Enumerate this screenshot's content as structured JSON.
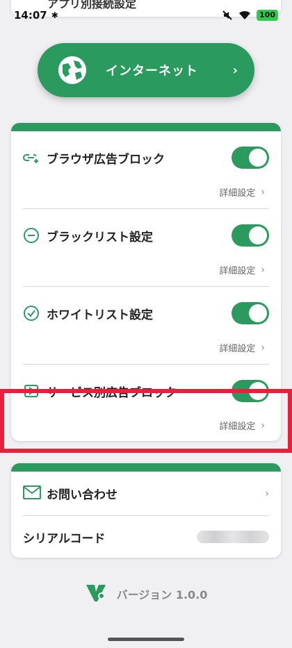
{
  "status_bar": {
    "time": "14:07",
    "battery": "100"
  },
  "top_card": {
    "label": "アプリ別接続設定"
  },
  "internet_button": {
    "label": "インターネット"
  },
  "settings": [
    {
      "label": "ブラウザ広告ブロック",
      "icon": "link-plus-icon",
      "enabled": true,
      "detail": "詳細設定"
    },
    {
      "label": "ブラックリスト設定",
      "icon": "minus-circle-icon",
      "enabled": true,
      "detail": "詳細設定"
    },
    {
      "label": "ホワイトリスト設定",
      "icon": "check-circle-icon",
      "enabled": true,
      "detail": "詳細設定"
    },
    {
      "label": "サービス別広告ブロック",
      "icon": "play-icon",
      "enabled": true,
      "detail": "詳細設定"
    }
  ],
  "contact": {
    "label": "お問い合わせ",
    "icon": "mail-icon"
  },
  "serial": {
    "label": "シリアルコード"
  },
  "version": {
    "label": "バージョン 1.0.0"
  },
  "colors": {
    "brand": "#2a9a5e",
    "background": "#f0f0f3",
    "highlight": "#e8203c"
  }
}
